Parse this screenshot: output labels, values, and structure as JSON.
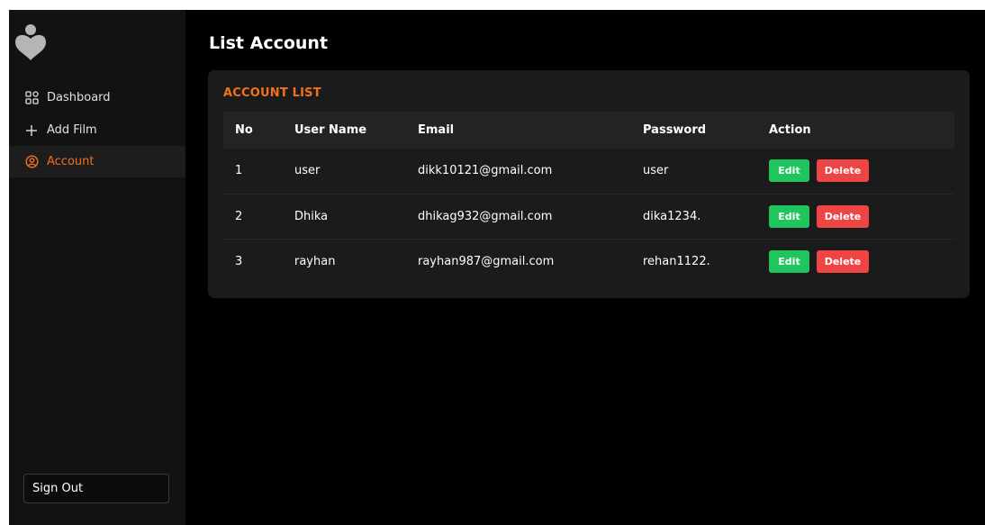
{
  "sidebar": {
    "items": [
      {
        "label": "Dashboard",
        "icon": "grid-icon"
      },
      {
        "label": "Add Film",
        "icon": "plus-icon"
      },
      {
        "label": "Account",
        "icon": "user-circle-icon",
        "active": true
      }
    ],
    "sign_out_label": "Sign Out"
  },
  "main": {
    "title": "List Account",
    "card_title": "ACCOUNT LIST",
    "table": {
      "headers": [
        "No",
        "User Name",
        "Email",
        "Password",
        "Action"
      ],
      "rows": [
        {
          "no": "1",
          "username": "user",
          "email": "dikk10121@gmail.com",
          "password": "user"
        },
        {
          "no": "2",
          "username": "Dhika",
          "email": "dhikag932@gmail.com",
          "password": "dika1234."
        },
        {
          "no": "3",
          "username": "rayhan",
          "email": "rayhan987@gmail.com",
          "password": "rehan1122."
        }
      ],
      "edit_label": "Edit",
      "delete_label": "Delete"
    }
  },
  "colors": {
    "accent": "#f2711c",
    "edit": "#21c55d",
    "delete": "#ef4444",
    "background": "#000000",
    "sidebar": "#121212",
    "card": "#1b1b1b"
  }
}
